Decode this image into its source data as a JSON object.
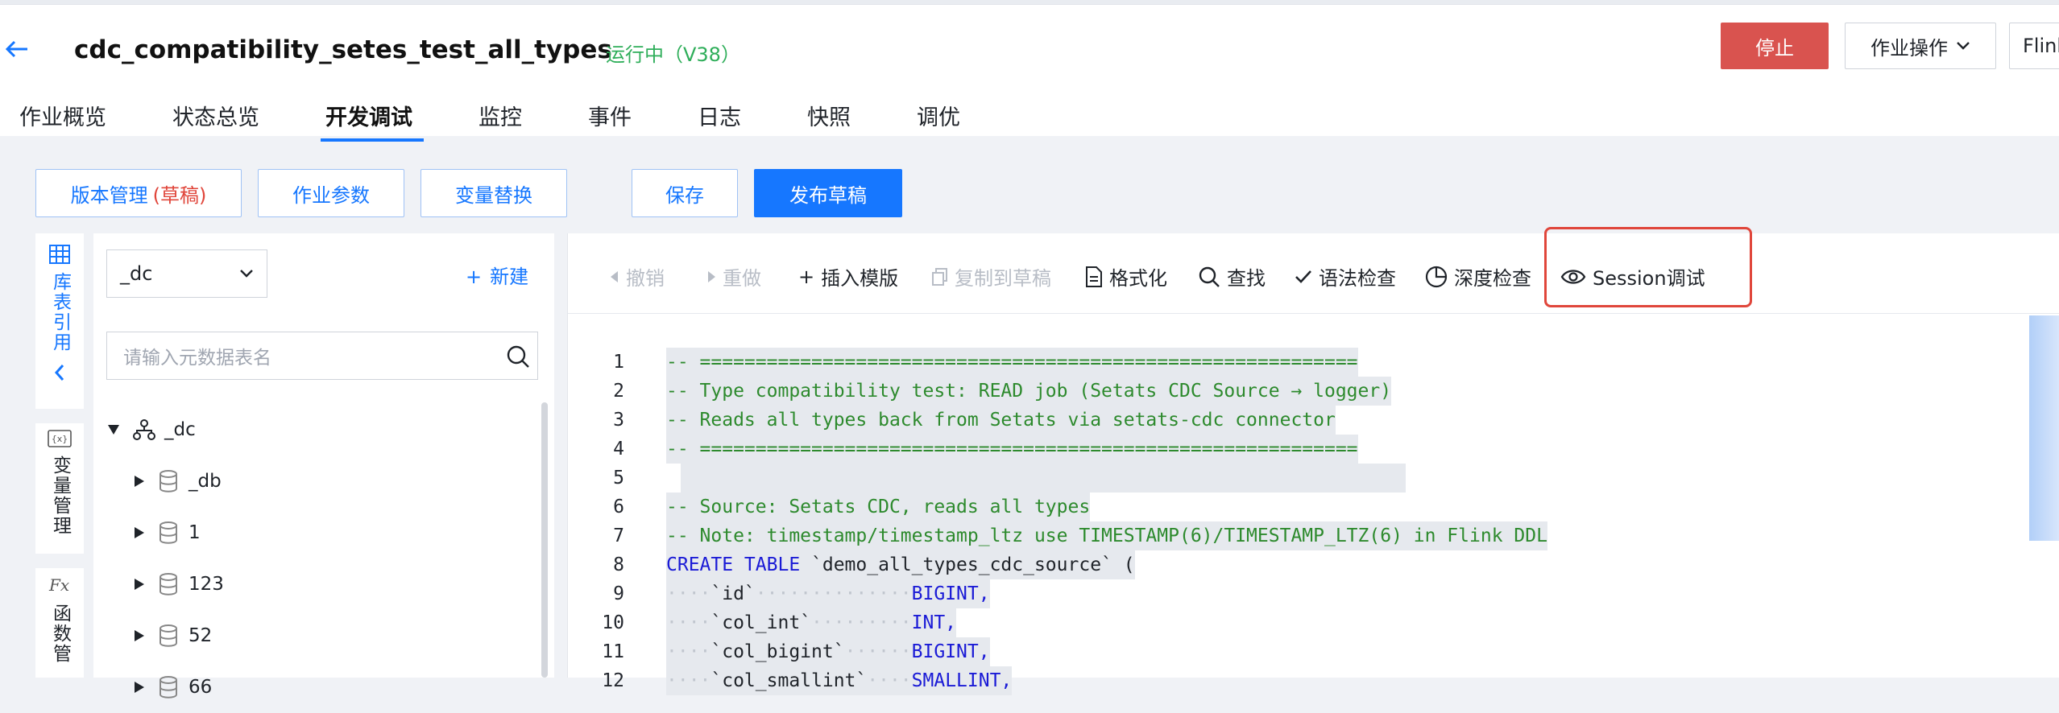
{
  "header": {
    "back_icon": "arrow-left-icon",
    "job_title": "cdc_compatibility_setes_test_all_types",
    "status": "运行中（V38）",
    "stop_label": "停止",
    "ops_label": "作业操作",
    "flink_label": "Flink"
  },
  "tabs": [
    {
      "label": "作业概览"
    },
    {
      "label": "状态总览"
    },
    {
      "label": "开发调试",
      "active": true
    },
    {
      "label": "监控"
    },
    {
      "label": "事件"
    },
    {
      "label": "日志"
    },
    {
      "label": "快照"
    },
    {
      "label": "调优"
    }
  ],
  "toolbar": {
    "version_label": "版本管理",
    "version_draft": "(草稿)",
    "params_label": "作业参数",
    "vars_label": "变量替换",
    "save_label": "保存",
    "publish_label": "发布草稿"
  },
  "leftbar": {
    "lib_label": "库表引用",
    "var_label": "变量管理",
    "func_label": "函数管"
  },
  "tree_panel": {
    "catalog_value": "_dc",
    "new_label": "新建",
    "search_placeholder": "请输入元数据表名",
    "root": "_dc",
    "databases": [
      "_db",
      "1",
      "123",
      "52",
      "66"
    ]
  },
  "editor_toolbar": {
    "undo": "撤销",
    "redo": "重做",
    "insert_template": "插入模版",
    "copy_to_draft": "复制到草稿",
    "format": "格式化",
    "find": "查找",
    "syntax_check": "语法检查",
    "deep_check": "深度检查",
    "session_debug": "Session调试"
  },
  "code_lines": [
    {
      "n": "1",
      "text": "-- ===========================================================",
      "type": "cmt"
    },
    {
      "n": "2",
      "text": "-- Type compatibility test: READ job (Setats CDC Source → logger)",
      "type": "cmt"
    },
    {
      "n": "3",
      "text": "-- Reads all types back from Setats via setats-cdc connector",
      "type": "cmt"
    },
    {
      "n": "4",
      "text": "-- ===========================================================",
      "type": "cmt"
    },
    {
      "n": "5",
      "text": "",
      "type": "blank"
    },
    {
      "n": "6",
      "text": "-- Source: Setats CDC, reads all types",
      "type": "cmt"
    },
    {
      "n": "7",
      "text": "-- Note: timestamp/timestamp_ltz use TIMESTAMP(6)/TIMESTAMP_LTZ(6) in Flink DDL",
      "type": "cmt"
    },
    {
      "n": "8",
      "kw": "CREATE TABLE",
      "rest": " `demo_all_types_cdc_source` (",
      "type": "create"
    },
    {
      "n": "9",
      "col": "`id`",
      "dots": "··············",
      "dtype": "BIGINT,",
      "type": "col"
    },
    {
      "n": "10",
      "col": "`col_int`",
      "dots": "·········",
      "dtype": "INT,",
      "type": "col"
    },
    {
      "n": "11",
      "col": "`col_bigint`",
      "dots": "······",
      "dtype": "BIGINT,",
      "type": "col"
    },
    {
      "n": "12",
      "col": "`col_smallint`",
      "dots": "····",
      "dtype": "SMALLINT,",
      "type": "col"
    }
  ]
}
